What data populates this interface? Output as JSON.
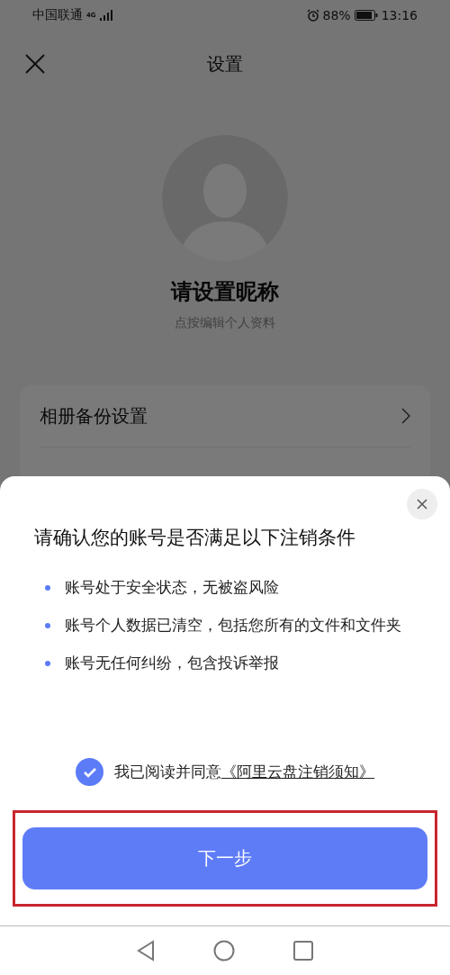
{
  "status_bar": {
    "carrier": "中国联通",
    "network": "4G",
    "battery": "88%",
    "time": "13:16"
  },
  "header": {
    "title": "设置"
  },
  "profile": {
    "nickname": "请设置昵称",
    "hint": "点按编辑个人资料"
  },
  "settings_items": [
    {
      "label": "相册备份设置"
    }
  ],
  "dialog": {
    "title": "请确认您的账号是否满足以下注销条件",
    "conditions": [
      "账号处于安全状态，无被盗风险",
      "账号个人数据已清空，包括您所有的文件和文件夹",
      "账号无任何纠纷，包含投诉举报"
    ],
    "agreement": {
      "checked": true,
      "text": "我已阅读并同意",
      "link": "《阿里云盘注销须知》"
    },
    "button": {
      "label": "下一步",
      "highlighted": true
    }
  }
}
